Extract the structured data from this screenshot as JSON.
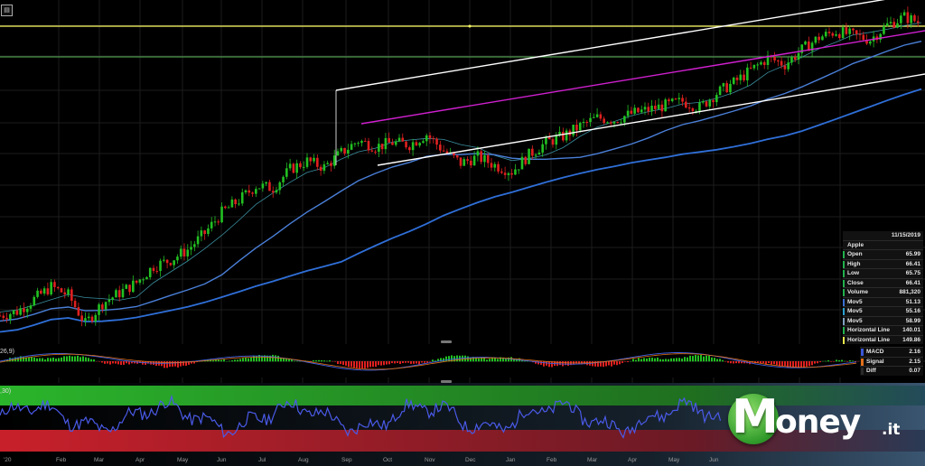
{
  "chart_data": [
    {
      "type": "candlestick",
      "instrument": "Apple",
      "x_tick_labels": [
        "'20",
        "Feb",
        "Mar",
        "Apr",
        "May",
        "Jun",
        "Jul",
        "Aug",
        "Sep",
        "Oct",
        "Nov",
        "Dec",
        "Jan",
        "Feb",
        "Mar",
        "Apr",
        "May",
        "Jun",
        "Jul"
      ],
      "series": [
        {
          "name": "Mov5",
          "color": "#4a7fd8",
          "values": []
        },
        {
          "name": "Mov5",
          "color": "#2f7ec9",
          "values": []
        },
        {
          "name": "Mov5",
          "color": "#6a8fb8",
          "values": []
        },
        {
          "name": "Horizontal Line",
          "color": "#5cb85c",
          "values": [
            140.01
          ]
        },
        {
          "name": "Horizontal Line",
          "color": "#ffff66",
          "values": [
            149.86
          ]
        }
      ],
      "close_path": [
        64,
        66,
        72,
        78,
        74,
        60,
        70,
        75,
        80,
        88,
        91,
        96,
        104,
        114,
        120,
        127,
        126,
        135,
        139,
        136,
        143,
        149,
        146,
        148,
        147,
        152,
        144,
        138,
        141,
        137,
        134,
        142,
        148,
        151,
        156,
        160,
        159,
        162,
        164,
        166,
        168,
        165,
        172,
        177,
        183,
        189,
        186,
        193,
        199,
        202,
        200,
        198,
        205,
        209,
        206
      ],
      "tooltip": {
        "date": "11/15/2019",
        "title": "Apple",
        "rows": [
          {
            "label": "Open",
            "value": "65.99",
            "color": "#22b14c"
          },
          {
            "label": "High",
            "value": "66.41",
            "color": "#22b14c"
          },
          {
            "label": "Low",
            "value": "65.75",
            "color": "#22b14c"
          },
          {
            "label": "Close",
            "value": "66.41",
            "color": "#22b14c"
          },
          {
            "label": "Volume",
            "value": "881,320",
            "color": "#22b14c"
          },
          {
            "label": "Mov5",
            "value": "51.13",
            "color": "#3a6fd0"
          },
          {
            "label": "Mov5",
            "value": "55.16",
            "color": "#2aa0d0"
          },
          {
            "label": "Mov5",
            "value": "58.99",
            "color": "#7fa0c0"
          },
          {
            "label": "Horizontal Line",
            "value": "140.01",
            "color": "#22b14c"
          },
          {
            "label": "Horizontal Line",
            "value": "149.86",
            "color": "#e8e84a"
          }
        ]
      }
    },
    {
      "type": "bar",
      "name": "MACD",
      "panel_label": "26,9)",
      "rows": [
        {
          "label": "MACD",
          "value": "2.16",
          "color": "#3a57d6"
        },
        {
          "label": "Signal",
          "value": "2.15",
          "color": "#e0701a"
        },
        {
          "label": "Diff",
          "value": "0.07",
          "color": "#2a2a2a"
        }
      ]
    },
    {
      "type": "line",
      "name": "Oscillator",
      "panel_label": ",30)",
      "overbought": 70,
      "oversold": 30
    }
  ],
  "toolbar_icon": "▤",
  "logo": {
    "first_letter": "M",
    "rest": "oney",
    "suffix": ".it"
  },
  "colors": {
    "bull": "#22c022",
    "bear": "#e02020",
    "channel": "#ffffff",
    "median": "#d020d0",
    "ma_slow": "#2f6fd8"
  }
}
